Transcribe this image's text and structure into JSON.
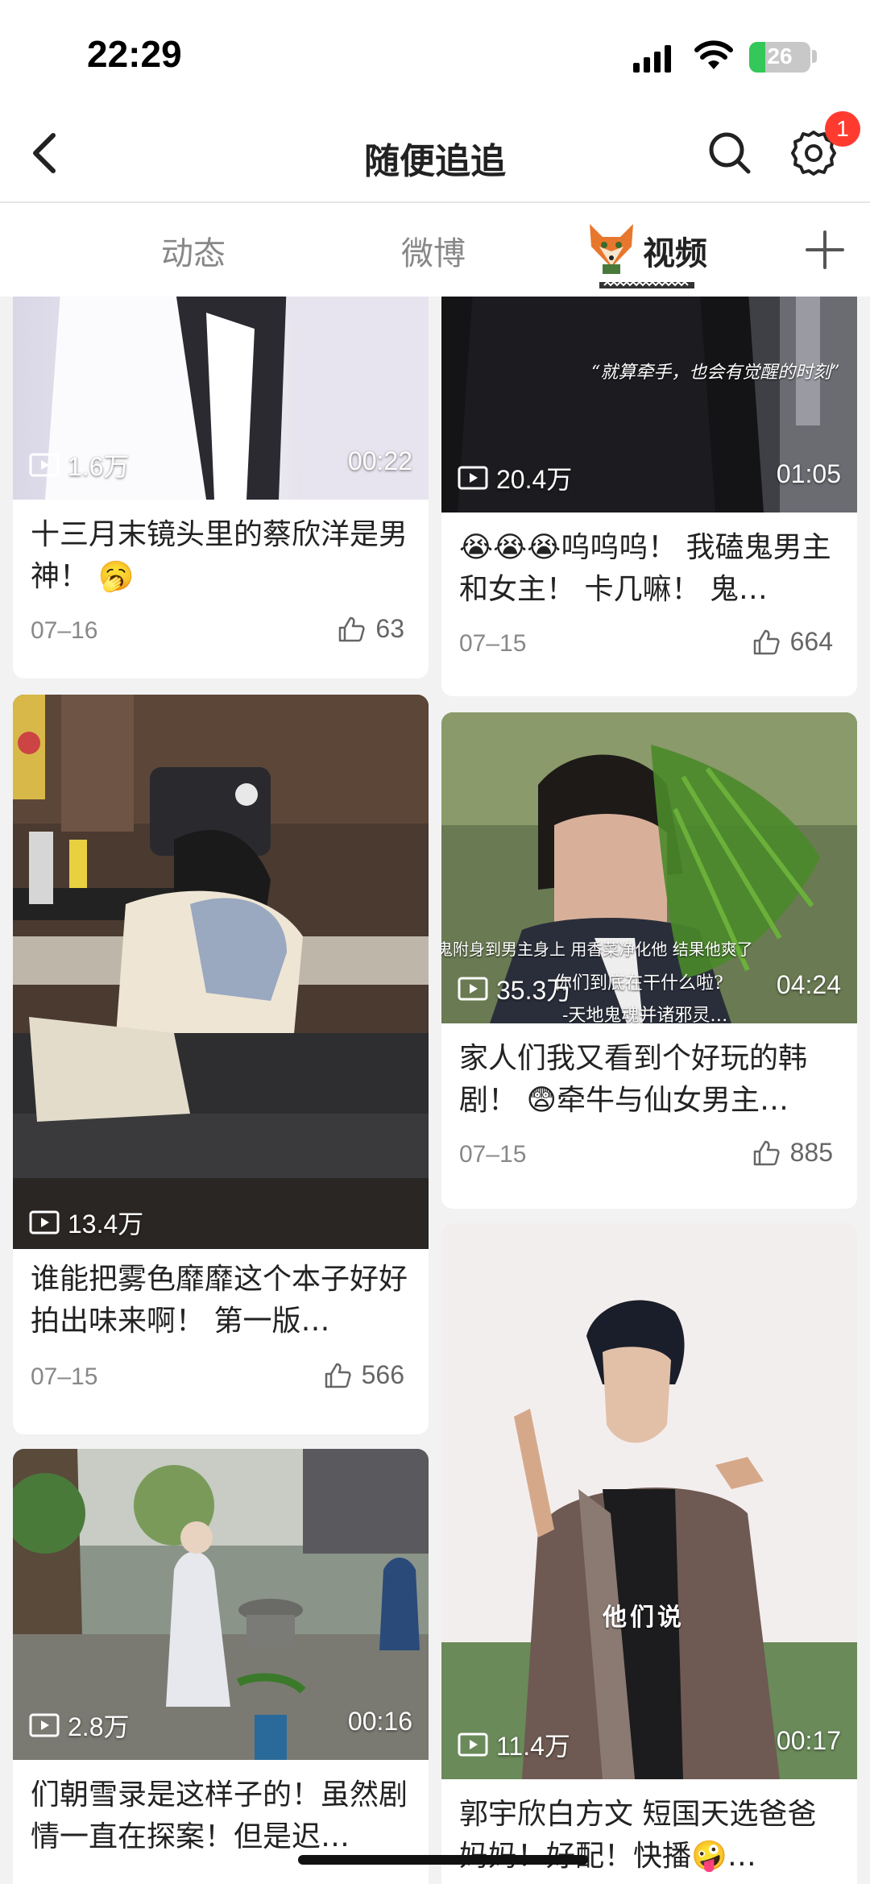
{
  "status": {
    "time": "22:29",
    "battery": "26"
  },
  "nav": {
    "title": "随便追追",
    "badge_count": "1"
  },
  "tabs": [
    {
      "label": "动态",
      "active": false
    },
    {
      "label": "微博",
      "active": false
    },
    {
      "label": "视频",
      "active": true
    }
  ],
  "cards": [
    {
      "title": "十三月末镜头里的蔡欣洋是男神！ 🥱",
      "plays": "1.6万",
      "duration": "00:22",
      "date": "07–16",
      "likes": "63"
    },
    {
      "title": "😭😭😭呜呜呜！ 我磕鬼男主和女主！ 卡几嘛！ 鬼…",
      "plays": "20.4万",
      "duration": "01:05",
      "date": "07–15",
      "likes": "664",
      "overlay": "“就算牵手，也会有觉醒的时刻”"
    },
    {
      "title": "谁能把雾色靡靡这个本子好好拍出味来啊！ 第一版…",
      "plays": "13.4万",
      "duration": "",
      "date": "07–15",
      "likes": "566"
    },
    {
      "title": "家人们我又看到个好玩的韩剧！ 😨牵牛与仙女男主…",
      "plays": "35.3万",
      "duration": "04:24",
      "date": "07–15",
      "likes": "885",
      "overlay": "鬼附身到男主身上 用香菜净化他 结果他爽了",
      "overlay2": "你们到底在干什么啦?",
      "overlay3": "-天地鬼魂并诸邪灵…"
    },
    {
      "title": "们朝雪录是这样子的！虽然剧情一直在探案！但是迟…",
      "plays": "2.8万",
      "duration": "00:16"
    },
    {
      "title": "郭宇欣白方文 短国天选爸爸妈妈！好配！快播🤪…",
      "plays": "11.4万",
      "duration": "00:17",
      "overlay": "他们说"
    }
  ],
  "colors": {
    "badge": "#ff3b30",
    "battery_fill": "#34c759"
  }
}
